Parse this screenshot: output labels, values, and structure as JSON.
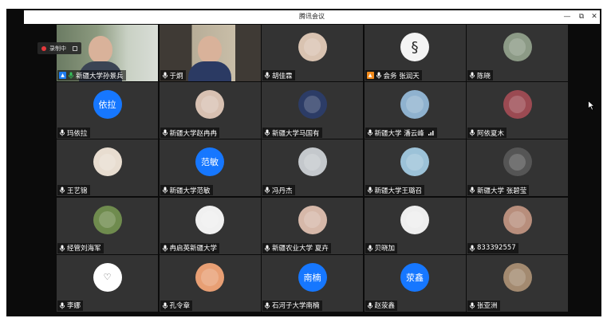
{
  "window": {
    "title": "腾讯会议",
    "controls": [
      "—",
      "⧉",
      "✕"
    ]
  },
  "recording": {
    "label": "录制中"
  },
  "colors": {
    "background": "#0b0b0b",
    "tile": "#333333",
    "text_avatar": "#1677ff",
    "record": "#e5393c",
    "mic": "#ffffff",
    "host_badge_blue": "#1f7cf0",
    "host_badge_orange": "#f18a1b"
  },
  "participants": [
    {
      "name": "新疆大学孙景兵",
      "type": "video",
      "badge": "host-blue",
      "mic": "green"
    },
    {
      "name": "于炯",
      "type": "video",
      "mic": "white"
    },
    {
      "name": "胡佳霖",
      "type": "photo",
      "avatar_icon": "woman-portrait-icon",
      "avatar_color": "#d9c3b1"
    },
    {
      "name": "会务 张润天",
      "type": "photo",
      "badge": "host-orange",
      "avatar_icon": "swirl-logo-icon",
      "avatar_color": "#f4f4f4"
    },
    {
      "name": "陈晓",
      "type": "photo",
      "avatar_icon": "landscape-icon",
      "avatar_color": "#8c9a86"
    },
    {
      "name": "玛依拉",
      "type": "text",
      "avatar_text": "依拉"
    },
    {
      "name": "新疆大学赵冉冉",
      "type": "photo",
      "avatar_icon": "baby-icon",
      "avatar_color": "#d8c1b2"
    },
    {
      "name": "新疆大学马国有",
      "type": "photo",
      "avatar_icon": "cartoon-character-icon",
      "avatar_color": "#2c3c66"
    },
    {
      "name": "新疆大学 潘云峰",
      "type": "photo",
      "avatar_icon": "sky-icon",
      "avatar_color": "#8fb2cf",
      "signal": true
    },
    {
      "name": "阿依夏木",
      "type": "photo",
      "avatar_icon": "flowers-icon",
      "avatar_color": "#9b4a52"
    },
    {
      "name": "王艺锦",
      "type": "photo",
      "avatar_icon": "dog-icon",
      "avatar_color": "#e8ddd0"
    },
    {
      "name": "新疆大学范敏",
      "type": "text",
      "avatar_text": "范敏"
    },
    {
      "name": "冯丹杰",
      "type": "photo",
      "avatar_icon": "person-icon",
      "avatar_color": "#c4c8cc"
    },
    {
      "name": "新疆大学王璐召",
      "type": "photo",
      "avatar_icon": "cartoon-icon",
      "avatar_color": "#9cc2d8"
    },
    {
      "name": "新疆大学 张碧莹",
      "type": "photo",
      "avatar_icon": "cat-icon",
      "avatar_color": "#555555"
    },
    {
      "name": "经管刘海军",
      "type": "photo",
      "avatar_icon": "plant-icon",
      "avatar_color": "#6f8b4e"
    },
    {
      "name": "冉启英新疆大学",
      "type": "photo",
      "avatar_icon": "astronaut-icon",
      "avatar_color": "#f0f0f0"
    },
    {
      "name": "新疆农业大学 夏卉",
      "type": "photo",
      "avatar_icon": "child-icon",
      "avatar_color": "#d6b8a9"
    },
    {
      "name": "贝晓加",
      "type": "photo",
      "avatar_icon": "dots-pattern-icon",
      "avatar_color": "#eeeeee"
    },
    {
      "name": "833392557",
      "type": "photo",
      "avatar_icon": "woman-icon",
      "avatar_color": "#b88e7c"
    },
    {
      "name": "李娜",
      "type": "photo",
      "avatar_icon": "heart-icon",
      "avatar_color": "#ffffff"
    },
    {
      "name": "孔令章",
      "type": "photo",
      "avatar_icon": "shiba-dog-icon",
      "avatar_color": "#e89f74"
    },
    {
      "name": "石河子大学南楠",
      "type": "text",
      "avatar_text": "南楠"
    },
    {
      "name": "赵荥鑫",
      "type": "text",
      "avatar_text": "荥鑫"
    },
    {
      "name": "张亚洲",
      "type": "photo",
      "avatar_icon": "tiger-icon",
      "avatar_color": "#a38a70"
    }
  ]
}
